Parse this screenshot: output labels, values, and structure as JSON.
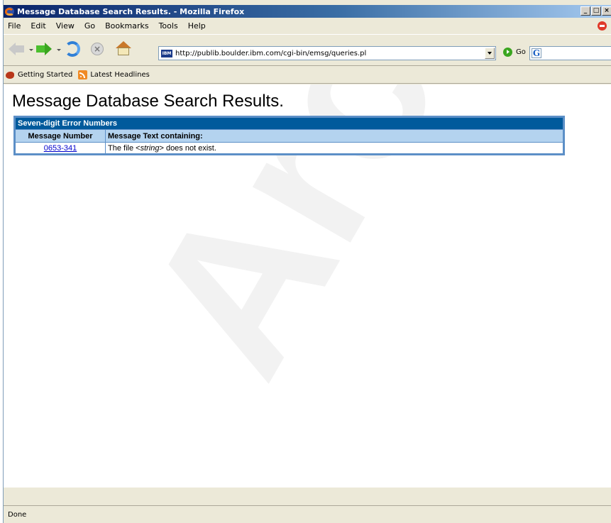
{
  "window": {
    "title": "Message Database Search Results. - Mozilla Firefox"
  },
  "menu": [
    {
      "label": "File"
    },
    {
      "label": "Edit"
    },
    {
      "label": "View"
    },
    {
      "label": "Go"
    },
    {
      "label": "Bookmarks"
    },
    {
      "label": "Tools"
    },
    {
      "label": "Help"
    }
  ],
  "navbar": {
    "site_icon_text": "IBM",
    "url": "http://publib.boulder.ibm.com/cgi-bin/emsg/queries.pl",
    "go_label": "Go",
    "search_engine_glyph": "G"
  },
  "bookmarks": [
    {
      "label": "Getting Started",
      "icon": "firefox-icon"
    },
    {
      "label": "Latest Headlines",
      "icon": "rss-icon"
    }
  ],
  "page": {
    "title": "Message Database Search Results.",
    "table": {
      "caption": "Seven-digit Error Numbers",
      "columns": [
        "Message Number",
        "Message Text containing:"
      ],
      "rows": [
        {
          "number": "0653-341",
          "text_before": "The file <",
          "text_italic": "string",
          "text_after": "> does not exist."
        }
      ]
    }
  },
  "watermark": "Archived",
  "status": {
    "text": "Done"
  },
  "colors": {
    "table_header": "#005a9c",
    "table_subheader": "#b4d3ef",
    "link": "#0000cc"
  }
}
